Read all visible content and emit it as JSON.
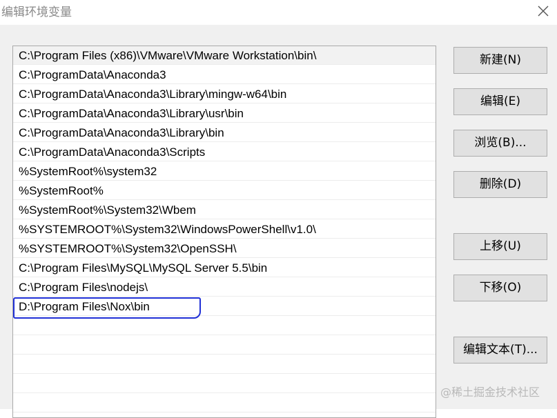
{
  "window": {
    "title": "编辑环境变量",
    "close_icon": "close-icon"
  },
  "path_list": {
    "entries": [
      "C:\\Program Files (x86)\\VMware\\VMware Workstation\\bin\\",
      "C:\\ProgramData\\Anaconda3",
      "C:\\ProgramData\\Anaconda3\\Library\\mingw-w64\\bin",
      "C:\\ProgramData\\Anaconda3\\Library\\usr\\bin",
      "C:\\ProgramData\\Anaconda3\\Library\\bin",
      "C:\\ProgramData\\Anaconda3\\Scripts",
      "%SystemRoot%\\system32",
      "%SystemRoot%",
      "%SystemRoot%\\System32\\Wbem",
      "%SYSTEMROOT%\\System32\\WindowsPowerShell\\v1.0\\",
      "%SYSTEMROOT%\\System32\\OpenSSH\\",
      "C:\\Program Files\\MySQL\\MySQL Server 5.5\\bin",
      "C:\\Program Files\\nodejs\\",
      "D:\\Program Files\\Nox\\bin"
    ],
    "selected_index": 0,
    "annotated_index": 13,
    "annotation_color": "#1f2fd6"
  },
  "buttons": {
    "new": "新建(N)",
    "edit": "编辑(E)",
    "browse": "浏览(B)...",
    "delete": "删除(D)",
    "move_up": "上移(U)",
    "move_down": "下移(O)",
    "edit_text": "编辑文本(T)..."
  },
  "watermark": "@稀土掘金技术社区"
}
